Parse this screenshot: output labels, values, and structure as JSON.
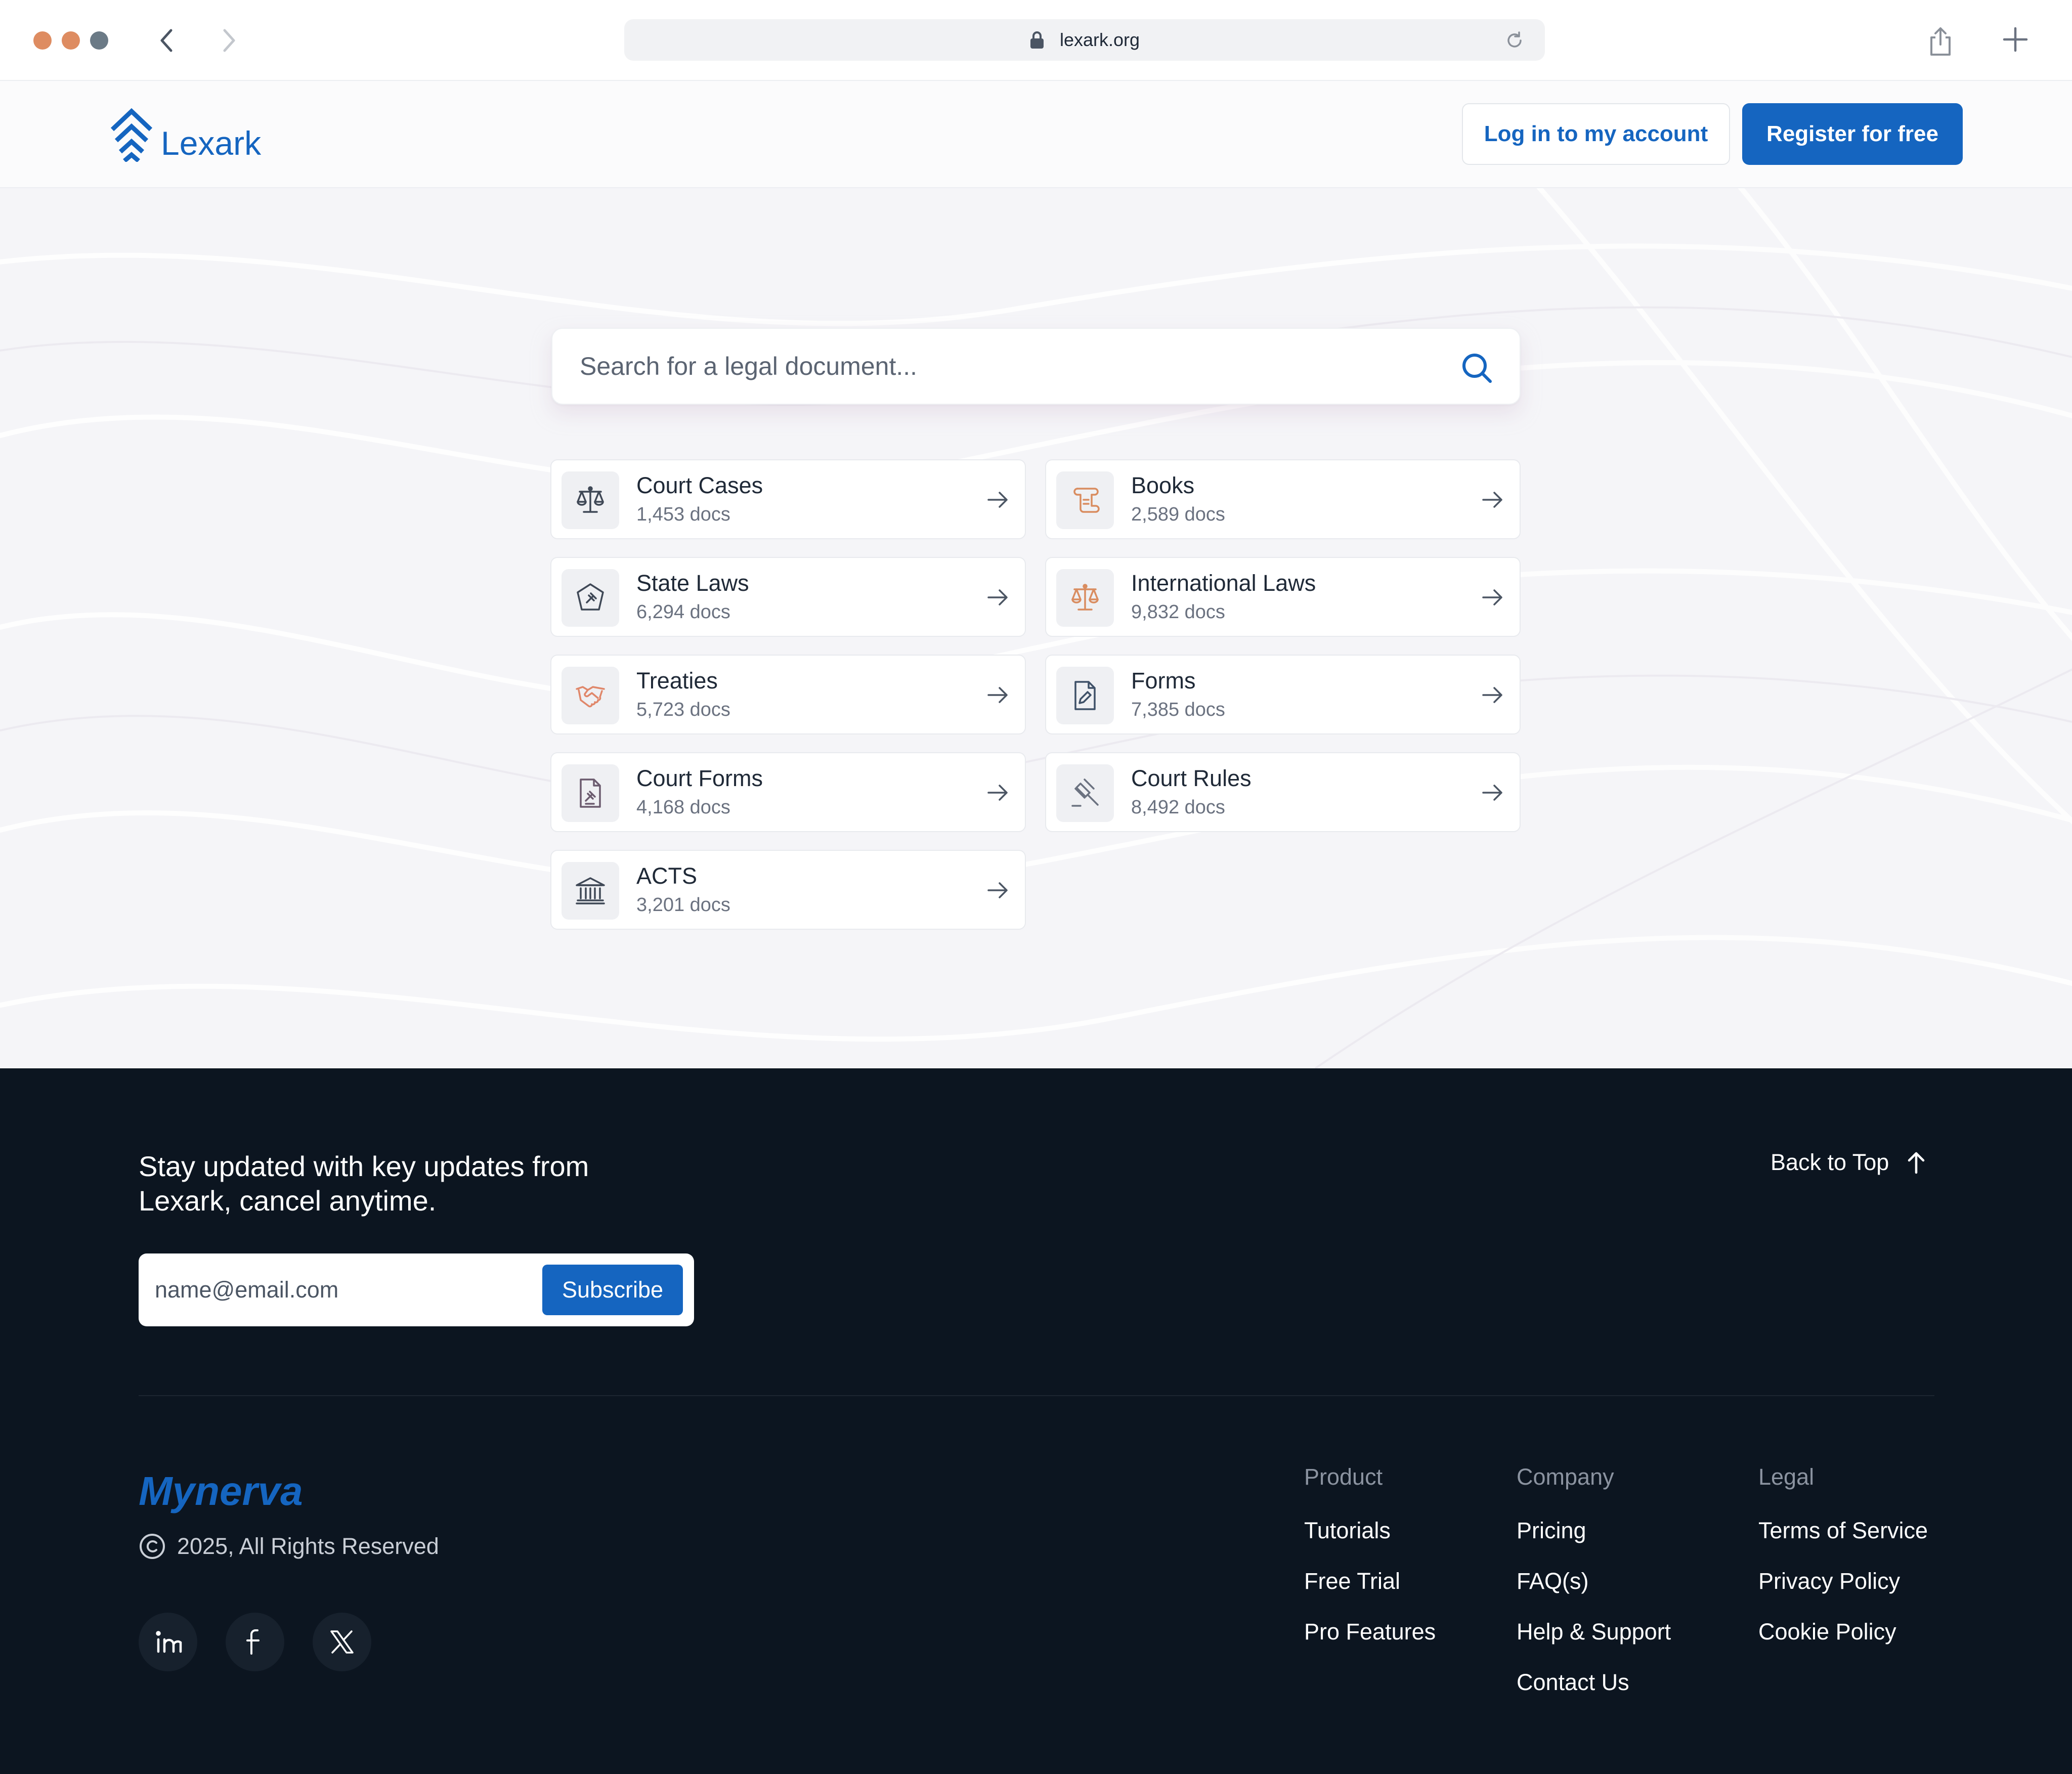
{
  "browser": {
    "url": "lexark.org"
  },
  "header": {
    "brand": "Lexark",
    "login_label": "Log in to my account",
    "register_label": "Register for free"
  },
  "search": {
    "placeholder": "Search for a legal document..."
  },
  "categories": [
    {
      "title": "Court Cases",
      "count": "1,453 docs",
      "icon": "scales-icon",
      "color": "#3f4856"
    },
    {
      "title": "Books",
      "count": "2,589 docs",
      "icon": "scroll-icon",
      "color": "#d98c5f"
    },
    {
      "title": "State Laws",
      "count": "6,294 docs",
      "icon": "gavel-badge-icon",
      "color": "#3f4856"
    },
    {
      "title": "International Laws",
      "count": "9,832 docs",
      "icon": "scales-icon",
      "color": "#d98c5f"
    },
    {
      "title": "Treaties",
      "count": "5,723 docs",
      "icon": "handshake-icon",
      "color": "#e0876a"
    },
    {
      "title": "Forms",
      "count": "7,385 docs",
      "icon": "document-edit-icon",
      "color": "#3f5168"
    },
    {
      "title": "Court Forms",
      "count": "4,168 docs",
      "icon": "document-gavel-icon",
      "color": "#6b5b6e"
    },
    {
      "title": "Court Rules",
      "count": "8,492 docs",
      "icon": "gavel-icon",
      "color": "#6b7280"
    },
    {
      "title": "ACTS",
      "count": "3,201 docs",
      "icon": "courthouse-icon",
      "color": "#3f4856"
    }
  ],
  "footer": {
    "newsletter_line1": "Stay updated with key updates from",
    "newsletter_line2": "Lexark, cancel anytime.",
    "email_placeholder": "name@email.com",
    "subscribe_label": "Subscribe",
    "back_to_top": "Back to Top",
    "brand": "Mynerva",
    "copyright": "2025, All Rights Reserved",
    "socials": [
      "linkedin-icon",
      "facebook-icon",
      "x-icon"
    ],
    "columns": {
      "product": {
        "heading": "Product",
        "links": [
          "Tutorials",
          "Free Trial",
          "Pro Features"
        ]
      },
      "company": {
        "heading": "Company",
        "links": [
          "Pricing",
          "FAQ(s)",
          "Help & Support",
          "Contact Us"
        ]
      },
      "legal": {
        "heading": "Legal",
        "links": [
          "Terms of Service",
          "Privacy Policy",
          "Cookie Policy"
        ]
      }
    }
  },
  "colors": {
    "accent": "#1565c0",
    "footer_bg": "#0c1520",
    "hero_bg": "#f5f5f8"
  }
}
